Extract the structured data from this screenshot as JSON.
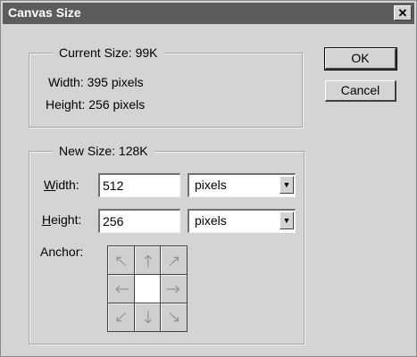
{
  "dialog": {
    "title": "Canvas Size",
    "close_glyph": "✕"
  },
  "current": {
    "group_title": "Current Size: 99K",
    "width": "Width: 395 pixels",
    "height": "Height: 256 pixels"
  },
  "buttons": {
    "ok": "OK",
    "cancel": "Cancel"
  },
  "new_size": {
    "group_title": "New Size: 128K",
    "width_label_first": "W",
    "width_label_rest": "idth:",
    "width_value": "512",
    "width_unit": "pixels",
    "height_label_first": "H",
    "height_label_rest": "eight:",
    "height_value": "256",
    "height_unit": "pixels",
    "anchor_label": "Anchor:"
  },
  "anchor": {
    "selected": "center",
    "cells": [
      {
        "pos": "top-left",
        "icon": "arrow-up-left-icon"
      },
      {
        "pos": "top",
        "icon": "arrow-up-icon"
      },
      {
        "pos": "top-right",
        "icon": "arrow-up-right-icon"
      },
      {
        "pos": "left",
        "icon": "arrow-left-icon"
      },
      {
        "pos": "center",
        "icon": "anchor-selected"
      },
      {
        "pos": "right",
        "icon": "arrow-right-icon"
      },
      {
        "pos": "bottom-left",
        "icon": "arrow-down-left-icon"
      },
      {
        "pos": "bottom",
        "icon": "arrow-down-icon"
      },
      {
        "pos": "bottom-right",
        "icon": "arrow-down-right-icon"
      }
    ]
  }
}
